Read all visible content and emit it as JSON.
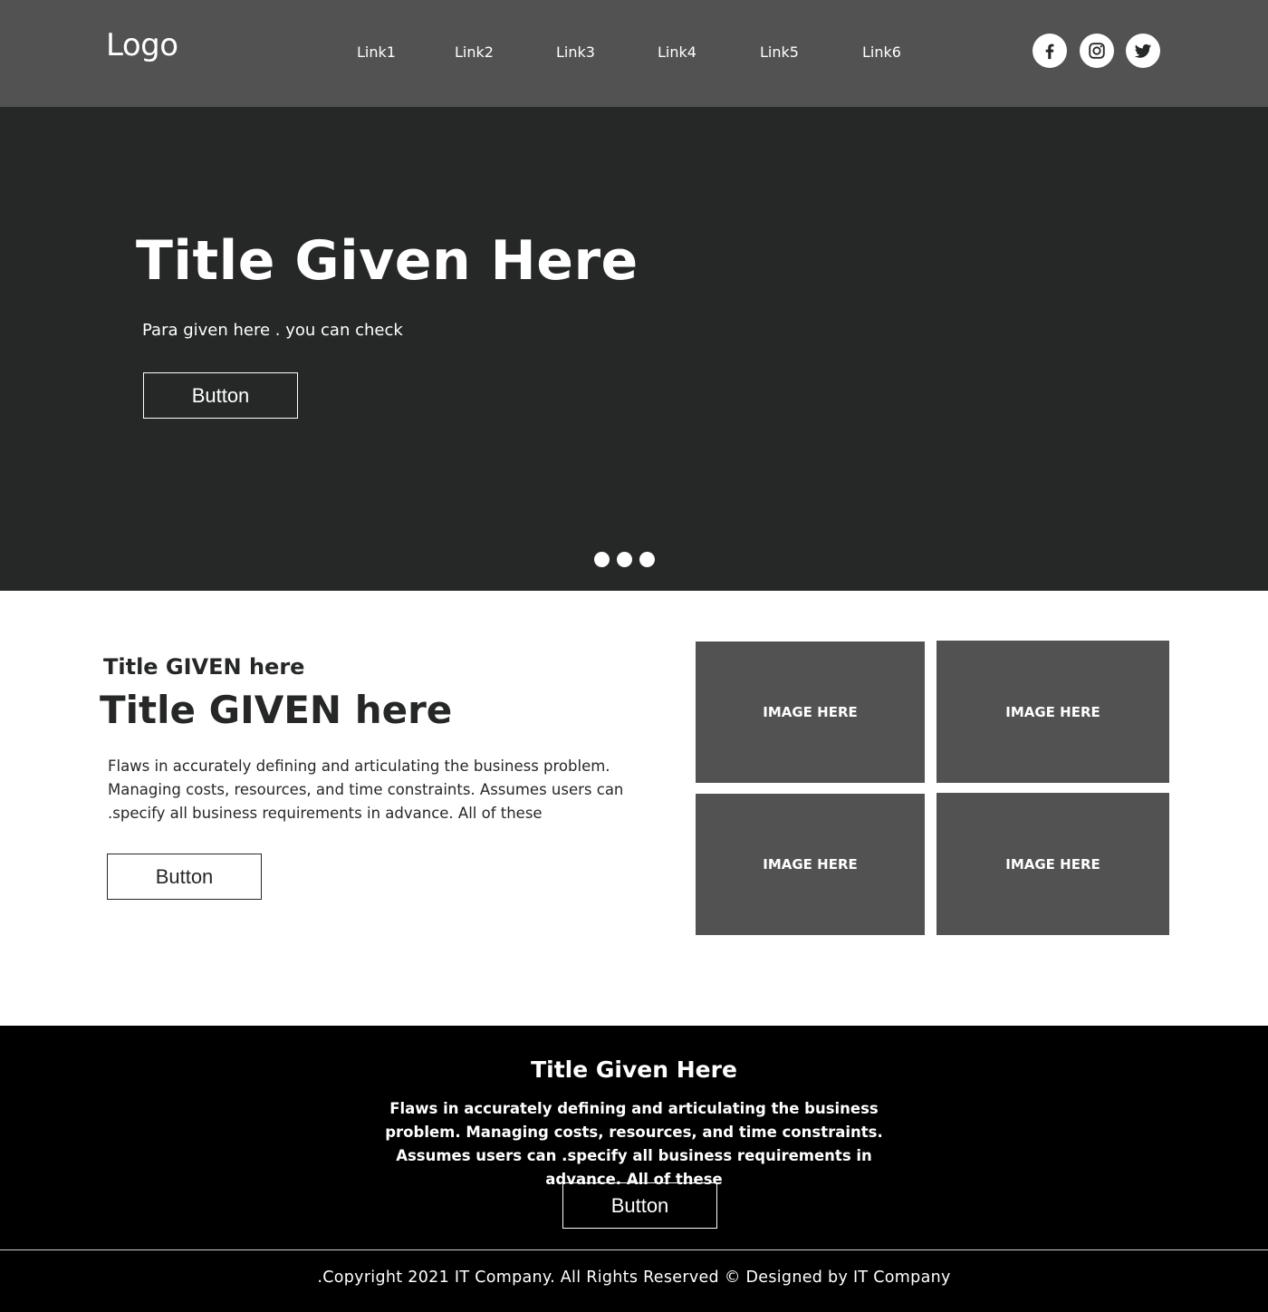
{
  "header": {
    "logo": "Logo",
    "nav": [
      "Link1",
      "Link2",
      "Link3",
      "Link4",
      "Link5",
      "Link6"
    ],
    "social_icons": [
      "facebook-icon",
      "instagram-icon",
      "twitter-icon"
    ]
  },
  "hero": {
    "title": "Title Given Here",
    "paragraph": "Para given here . you can check",
    "button_label": "Button",
    "slider_dots": 3
  },
  "content": {
    "subtitle": "Title GIVEN here",
    "title": "Title GIVEN here",
    "paragraph": "Flaws in accurately defining and articulating the business problem. Managing costs, resources, and time constraints. Assumes users can .specify all business requirements in advance. All of these",
    "button_label": "Button",
    "images": [
      "IMAGE HERE",
      "IMAGE HERE",
      "IMAGE HERE",
      "IMAGE HERE"
    ]
  },
  "footer": {
    "title": "Title Given Here",
    "paragraph": "Flaws in accurately defining and articulating the business problem. Managing costs, resources, and time constraints. Assumes users can .specify all business requirements in advance. All of these",
    "button_label": "Button",
    "copyright": ".Copyright 2021 IT Company. All Rights Reserved ©  Designed by IT Company"
  },
  "colors": {
    "header_bg": "#525252",
    "hero_bg": "#262727",
    "image_placeholder": "#525252",
    "footer_bg": "#000000",
    "text_dark": "#262727",
    "text_light": "#ffffff"
  }
}
